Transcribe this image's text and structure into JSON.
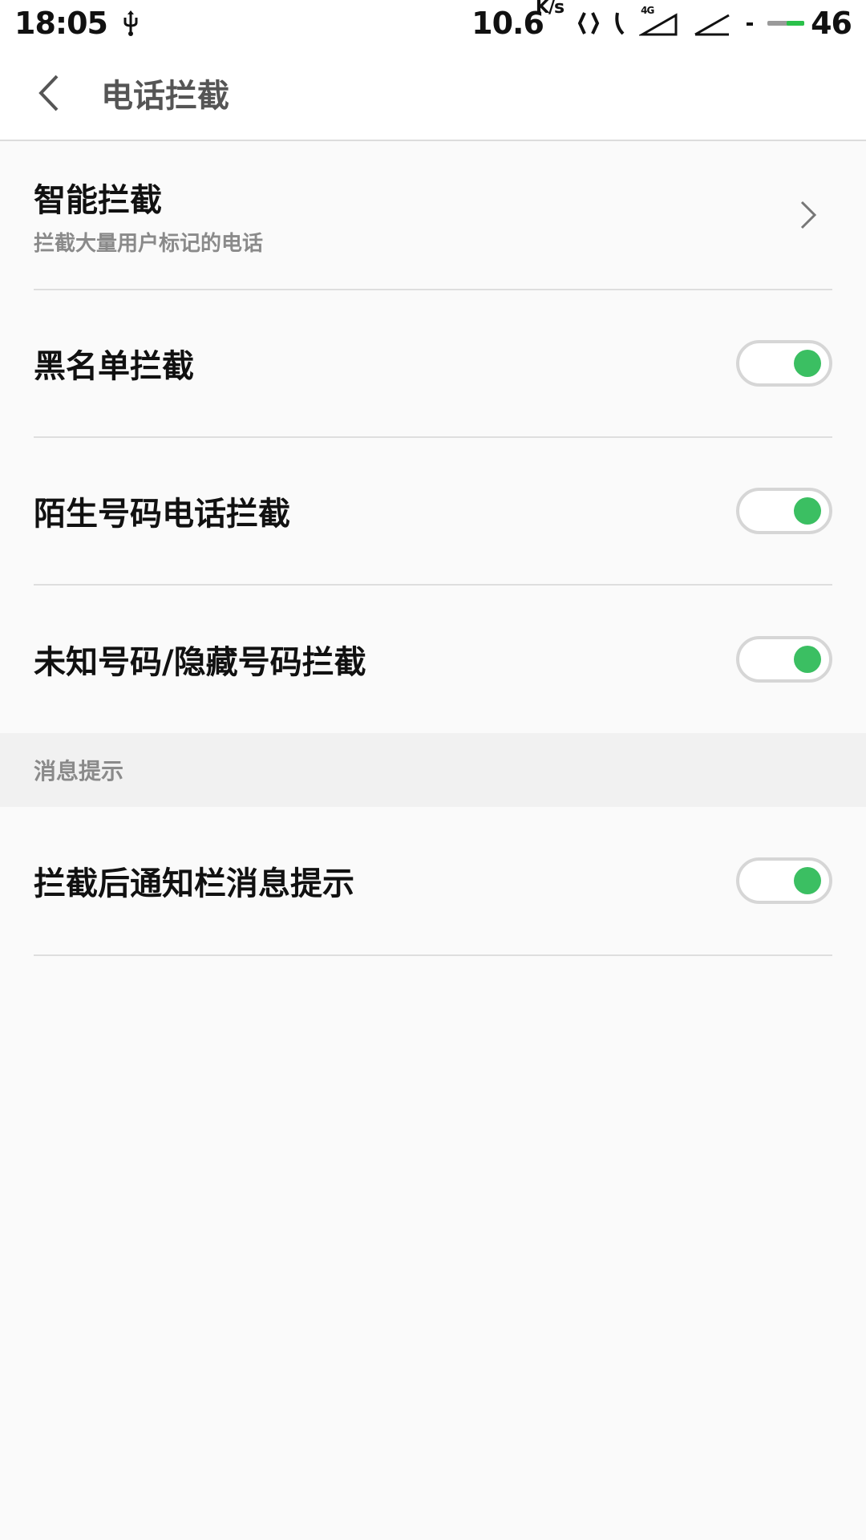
{
  "status_bar": {
    "time": "18:05",
    "net_speed": "10.6",
    "net_unit": "K/s",
    "network_label": "4G",
    "battery": "46"
  },
  "header": {
    "title": "电话拦截"
  },
  "settings": {
    "smart": {
      "title": "智能拦截",
      "subtitle": "拦截大量用户标记的电话"
    },
    "blacklist": {
      "title": "黑名单拦截",
      "enabled": true
    },
    "stranger": {
      "title": "陌生号码电话拦截",
      "enabled": true
    },
    "unknown": {
      "title": "未知号码/隐藏号码拦截",
      "enabled": true
    }
  },
  "notify_section": {
    "header": "消息提示",
    "notify_toggle": {
      "title": "拦截后通知栏消息提示",
      "enabled": true
    }
  },
  "colors": {
    "toggle_on": "#3bbf62",
    "battery_fill": "#2ac14a"
  }
}
